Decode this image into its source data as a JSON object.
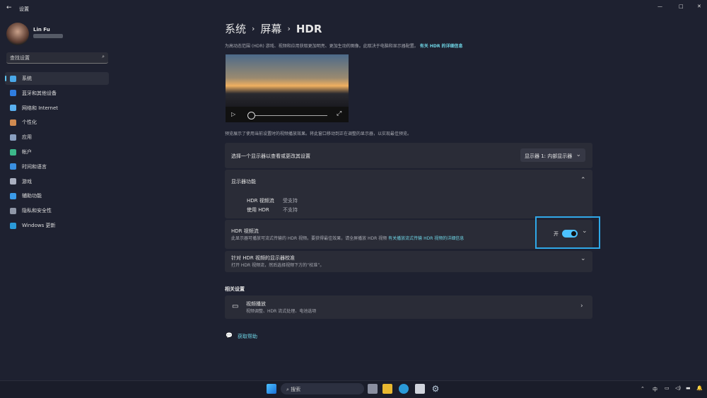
{
  "window": {
    "title": "设置",
    "back": "←",
    "controls": [
      "—",
      "□",
      "✕"
    ]
  },
  "user": {
    "name": "Lin Fu"
  },
  "search": {
    "placeholder": "查找设置"
  },
  "nav": [
    {
      "label": "系统",
      "color": "#4aa8e8"
    },
    {
      "label": "蓝牙和其他设备",
      "color": "#2f7de0"
    },
    {
      "label": "网络和 Internet",
      "color": "#5ab0f0"
    },
    {
      "label": "个性化",
      "color": "#d08a50"
    },
    {
      "label": "应用",
      "color": "#8aa0c0"
    },
    {
      "label": "帐户",
      "color": "#3cb88a"
    },
    {
      "label": "时间和语言",
      "color": "#3a8fe0"
    },
    {
      "label": "游戏",
      "color": "#aab0c0"
    },
    {
      "label": "辅助功能",
      "color": "#3a9ae8"
    },
    {
      "label": "隐私和安全性",
      "color": "#9098a8"
    },
    {
      "label": "Windows 更新",
      "color": "#2a9ad8"
    }
  ],
  "breadcrumb": {
    "a": "系统",
    "b": "屏幕",
    "c": "HDR",
    "sep": "›"
  },
  "description": "为高动态范围 (HDR) 游戏、视频和应用获取更加明亮、更加生动的图像。此取决于电脑和显示器配置。",
  "description_link": "有关 HDR 的详细信息",
  "preview_note": "预览展示了使用当前设置时的视频播放效果。将此窗口移动到正在调整的显示器，以实现最佳预览。",
  "select_display": {
    "label": "选择一个显示器以查看或更改其设置",
    "value": "显示器 1: 内部显示器"
  },
  "capabilities": {
    "title": "显示器功能",
    "rows": [
      {
        "k": "HDR 视频流",
        "v": "受支持"
      },
      {
        "k": "使用 HDR",
        "v": "不支持"
      }
    ]
  },
  "hdr_stream": {
    "title": "HDR 视频流",
    "desc": "此显示器可播放可流式传输的 HDR 视频。要获得最佳效果，请全屏播放 HDR 视频",
    "link": "有关播放流式传输 HDR 视频的详细信息",
    "state": "开",
    "on": true
  },
  "calibration": {
    "title": "针对 HDR 视频的显示器校准",
    "desc": "打开 HDR 视频流，然后选择视频下方的“校准”。"
  },
  "related": {
    "heading": "相关设置",
    "title": "视频播放",
    "desc": "视频调整、HDR 流式处理、电池选项"
  },
  "help": "获取帮助",
  "taskbar": {
    "search": "搜索",
    "ime": "中"
  }
}
